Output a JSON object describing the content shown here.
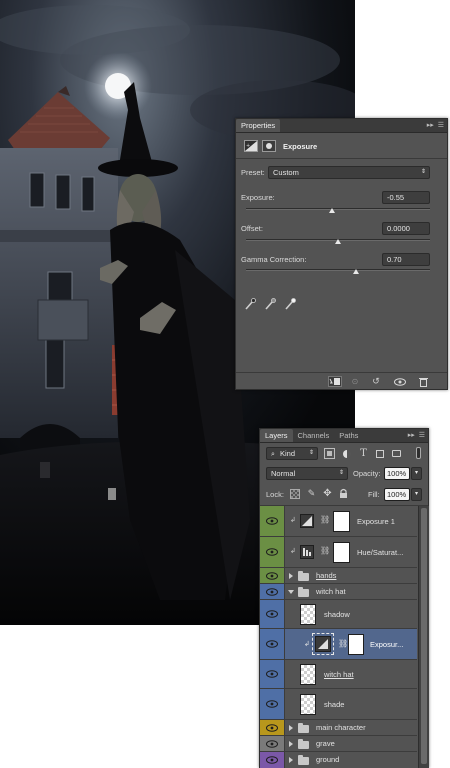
{
  "colors": {
    "panel_bg": "#535353",
    "green_label": "#6b8f44",
    "blue_label": "#4f6fa6",
    "yellow_label": "#b8971c",
    "gray_label": "#7a7a7a",
    "violet_label": "#7b58a8",
    "selected_row": "#52678d"
  },
  "properties": {
    "tab": "Properties",
    "title": "Exposure",
    "preset_label": "Preset:",
    "preset_value": "Custom",
    "exposure_label": "Exposure:",
    "exposure_value": "-0.55",
    "offset_label": "Offset:",
    "offset_value": "0.0000",
    "gamma_label": "Gamma Correction:",
    "gamma_value": "0.70",
    "sliders": {
      "exposure": 0.47,
      "offset": 0.5,
      "gamma": 0.6
    },
    "eyedroppers": [
      "black-eyedropper-icon",
      "gray-eyedropper-icon",
      "white-eyedropper-icon"
    ],
    "footer_icons": [
      "clip-to-layer-icon",
      "view-previous-icon",
      "reset-icon",
      "visibility-icon",
      "delete-icon"
    ]
  },
  "layers": {
    "tabs": [
      "Layers",
      "Channels",
      "Paths"
    ],
    "filter_kind": "Kind",
    "blend_mode": "Normal",
    "opacity_label": "Opacity:",
    "opacity_value": "100%",
    "lock_label": "Lock:",
    "fill_label": "Fill:",
    "fill_value": "100%",
    "rows": [
      {
        "name": "Exposure 1",
        "label_color": "green",
        "type": "adjustment"
      },
      {
        "name": "Hue/Saturat...",
        "label_color": "green",
        "type": "adjustment"
      },
      {
        "name": "hands",
        "label_color": "green",
        "type": "group-closed"
      },
      {
        "name": "witch hat",
        "label_color": "blue",
        "type": "group-open"
      },
      {
        "name": "shadow",
        "label_color": "blue",
        "type": "layer"
      },
      {
        "name": "Exposur...",
        "label_color": "blue",
        "type": "adjustment-selected"
      },
      {
        "name": "witch hat",
        "label_color": "blue",
        "type": "layer"
      },
      {
        "name": "shade",
        "label_color": "blue",
        "type": "layer"
      },
      {
        "name": "main character",
        "label_color": "yellow",
        "type": "group-closed"
      },
      {
        "name": "grave",
        "label_color": "gray",
        "type": "group-closed"
      },
      {
        "name": "ground",
        "label_color": "violet",
        "type": "group-closed"
      }
    ]
  }
}
